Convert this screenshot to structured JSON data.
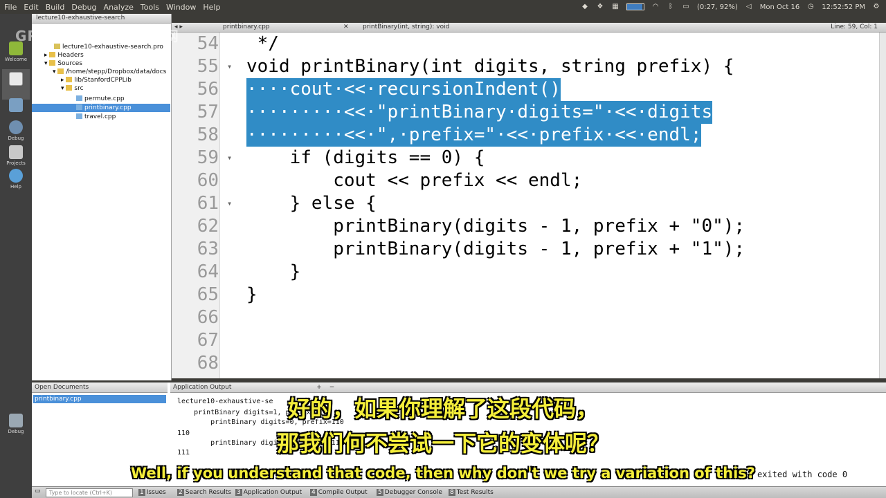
{
  "menubar": {
    "items": [
      "File",
      "Edit",
      "Build",
      "Debug",
      "Analyze",
      "Tools",
      "Window",
      "Help"
    ],
    "battery_text": "(0:27, 92%)",
    "battery_level_percent": 92,
    "date": "Mon Oct 16",
    "time": "12:52:52 PM"
  },
  "watermark": "GPT中英字幕课程资源网",
  "modebar": {
    "items": [
      {
        "label": "Welcome",
        "icon": "welcome-icon"
      },
      {
        "label": "",
        "icon": "edit-icon"
      },
      {
        "label": "",
        "icon": "design-icon"
      },
      {
        "label": "Debug",
        "icon": "debug-icon"
      },
      {
        "label": "Projects",
        "icon": "projects-icon"
      },
      {
        "label": "Help",
        "icon": "help-icon"
      },
      {
        "label": "Debug",
        "icon": "run-debug-icon"
      }
    ]
  },
  "project_tree": {
    "root": "lecture10-exhaustive-search",
    "items": [
      {
        "label": "lecture10-exhaustive-search.pro",
        "level": 1
      },
      {
        "label": "Headers",
        "level": 1
      },
      {
        "label": "Sources",
        "level": 1
      },
      {
        "label": "/home/stepp/Dropbox/data/docs",
        "level": 2
      },
      {
        "label": "lib/StanfordCPPLib",
        "level": 3
      },
      {
        "label": "src",
        "level": 3
      },
      {
        "label": "permute.cpp",
        "level": 4
      },
      {
        "label": "printbinary.cpp",
        "level": 4,
        "selected": true
      },
      {
        "label": "travel.cpp",
        "level": 4
      }
    ]
  },
  "editor": {
    "file_tab": "printbinary.cpp",
    "function_tab": "printBinary(int, string): void",
    "cursor_pos": "Line: 59, Col: 1",
    "lines": [
      {
        "num": "54",
        "text": " */",
        "fold": false
      },
      {
        "num": "55",
        "text": "void printBinary(int digits, string prefix) {",
        "fold": true
      },
      {
        "num": "56",
        "text": "····cout·<<·recursionIndent()",
        "selected": true
      },
      {
        "num": "57",
        "text": "·········<<·\"printBinary·digits=\"·<<·digits",
        "selected": true
      },
      {
        "num": "58",
        "text": "·········<<·\",·prefix=\"·<<·prefix·<<·endl;",
        "selected": true
      },
      {
        "num": "59",
        "text": "    if (digits == 0) {",
        "fold": true
      },
      {
        "num": "60",
        "text": "        cout << prefix << endl;"
      },
      {
        "num": "61",
        "text": "    } else {",
        "fold": true
      },
      {
        "num": "62",
        "text": "        printBinary(digits - 1, prefix + \"0\");"
      },
      {
        "num": "63",
        "text": "        printBinary(digits - 1, prefix + \"1\");"
      },
      {
        "num": "64",
        "text": "    }"
      },
      {
        "num": "65",
        "text": "}"
      },
      {
        "num": "66",
        "text": ""
      },
      {
        "num": "67",
        "text": ""
      },
      {
        "num": "68",
        "text": ""
      }
    ]
  },
  "bottom": {
    "open_documents_title": "Open Documents",
    "open_document": "printbinary.cpp",
    "app_output_title": "Application Output",
    "output_tab": "lecture10-exhaustive-se",
    "output_lines": [
      "    printBinary digits=1, prefix=11",
      "        printBinary digits=0, prefix=110",
      "110",
      "        printBinary digits=0, prefix=111",
      "111"
    ],
    "exit_text": "exited with code 0"
  },
  "statusbar": {
    "locate_placeholder": "Type to locate (Ctrl+K)",
    "tabs": [
      {
        "num": "1",
        "label": "Issues"
      },
      {
        "num": "2",
        "label": "Search Results"
      },
      {
        "num": "3",
        "label": "Application Output"
      },
      {
        "num": "4",
        "label": "Compile Output"
      },
      {
        "num": "5",
        "label": "Debugger Console"
      },
      {
        "num": "8",
        "label": "Test Results"
      }
    ]
  },
  "subtitles": {
    "zh_line1": "好的，如果你理解了这段代码，",
    "zh_line2": "那我们何不尝试一下它的变体呢？",
    "en": "Well, if you understand that code, then why don't we try a variation of this?"
  }
}
